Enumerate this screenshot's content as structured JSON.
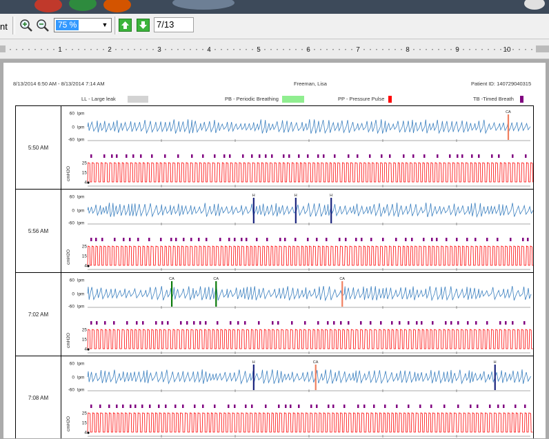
{
  "toolbar": {
    "cut_text": "nt",
    "zoom_value": "75 %",
    "page_value": "7/13",
    "icons": [
      "zoom-in-icon",
      "zoom-out-icon",
      "zoom-dropdown-icon",
      "page-up-icon",
      "page-down-icon"
    ]
  },
  "ruler": {
    "labels": [
      "1",
      "2",
      "3",
      "4",
      "5",
      "6",
      "7",
      "8",
      "9",
      "10"
    ]
  },
  "report": {
    "date_range": "8/13/2014  6:50 AM - 8/13/2014  7:14 AM",
    "patient_name": "Freeman, Lisa",
    "patient_id": "Patient ID: 140729040315",
    "legend": [
      {
        "label": "LL - Large leak",
        "color": "#d3d3d3"
      },
      {
        "label": "PB - Periodic Breathing",
        "color": "#90ee90"
      },
      {
        "label": "PP - Pressure Pulse",
        "color": "#ff0000"
      },
      {
        "label": "TB -Timed Breath",
        "color": "#800080"
      }
    ],
    "flow_axis": {
      "top": "60",
      "mid": "0",
      "bottom": "-60",
      "unit": "lpm"
    },
    "pressure_axis": {
      "ticks": [
        "25",
        "15",
        "4"
      ],
      "unit": "cmH2O"
    },
    "rows": [
      {
        "time": "5:50 AM",
        "events": [
          {
            "label": "CA",
            "pos": 0.95,
            "color": "#f08060"
          }
        ]
      },
      {
        "time": "5:56 AM",
        "events": [
          {
            "label": "H",
            "pos": 0.375,
            "color": "#1a237e"
          },
          {
            "label": "H",
            "pos": 0.47,
            "color": "#1a237e"
          },
          {
            "label": "H",
            "pos": 0.55,
            "color": "#1a237e"
          }
        ]
      },
      {
        "time": "7:02 AM",
        "events": [
          {
            "label": "CA",
            "pos": 0.19,
            "color": "#0a7a0a"
          },
          {
            "label": "CA",
            "pos": 0.29,
            "color": "#0a7a0a"
          },
          {
            "label": "CA",
            "pos": 0.575,
            "color": "#f08060"
          }
        ]
      },
      {
        "time": "7:08 AM",
        "events": [
          {
            "label": "H",
            "pos": 0.375,
            "color": "#1a237e"
          },
          {
            "label": "CA",
            "pos": 0.515,
            "color": "#f08060"
          },
          {
            "label": "H",
            "pos": 0.92,
            "color": "#1a237e"
          }
        ]
      }
    ]
  },
  "colors": {
    "flow": "#3a7fbf",
    "pressure": "#ff0000",
    "timed_breath": "#800080"
  }
}
